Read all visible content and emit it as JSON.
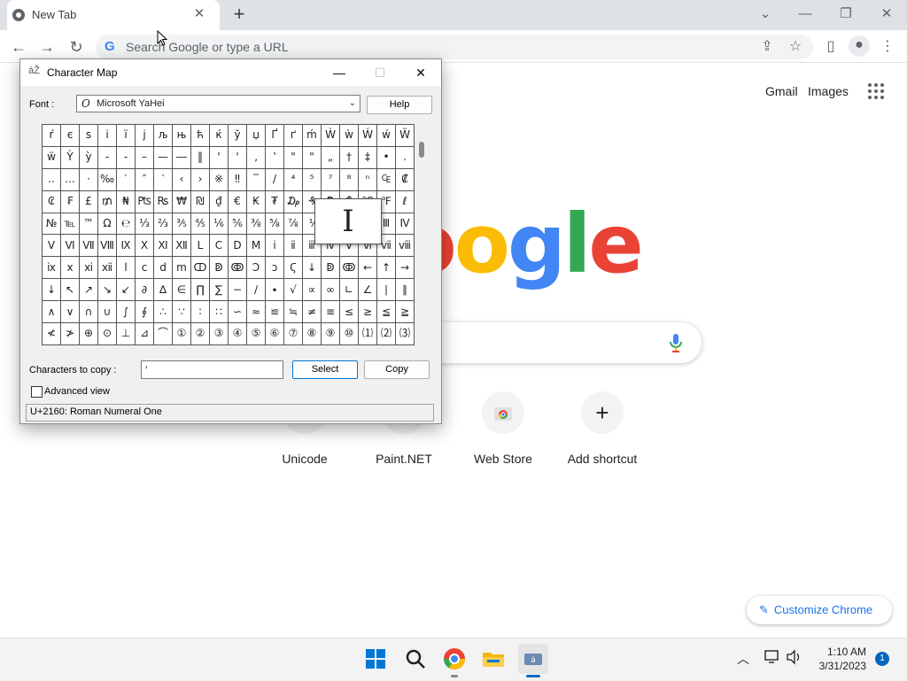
{
  "browser": {
    "tab_title": "New Tab",
    "tab_close": "✕",
    "new_tab": "+",
    "window_controls": {
      "dropdown": "⌄",
      "minimize": "—",
      "restore": "❐",
      "close": "✕"
    },
    "nav": {
      "back": "←",
      "forward": "→",
      "reload": "↻"
    },
    "omnibox_placeholder": "Search Google or type a URL",
    "toolbar_icons": [
      "share-icon",
      "star-icon",
      "sidepanel-icon",
      "profile-icon",
      "menu-icon"
    ]
  },
  "ntp": {
    "gmail": "Gmail",
    "images": "Images",
    "logo": "Google",
    "shortcuts": [
      {
        "label": "Unicode"
      },
      {
        "label": "Paint.NET"
      },
      {
        "label": "Web Store"
      },
      {
        "label": "Add shortcut",
        "icon": "+"
      }
    ],
    "customize": "Customize Chrome",
    "customize_icon": "✎"
  },
  "charmap": {
    "title": "Character Map",
    "controls": {
      "minimize": "—",
      "maximize": "☐",
      "close": "✕"
    },
    "font_label": "Font :",
    "font_glyph": "O",
    "font_value": "Microsoft YaHei",
    "help": "Help",
    "grid": [
      [
        "ŕ",
        "є",
        "s",
        "i",
        "ï",
        "j",
        "љ",
        "њ",
        "ћ",
        "ќ",
        "ў",
        "џ",
        "Ґ",
        "ґ",
        "ḿ",
        "Ẁ",
        "ẁ",
        "Ẃ",
        "ẃ",
        "Ẅ"
      ],
      [
        "ẅ",
        "Ỳ",
        "ỳ",
        "‐",
        "-",
        "–",
        "—",
        "―",
        "‖",
        "'",
        "'",
        "‚",
        "‛",
        "\"",
        "\"",
        "„",
        "†",
        "‡",
        "•",
        "."
      ],
      [
        "..",
        "…",
        "·",
        "‰",
        "′",
        "″",
        "‵",
        "‹",
        "›",
        "※",
        "‼",
        "‾",
        "/",
        "⁴",
        "⁵",
        "⁷",
        "⁸",
        "ⁿ",
        "₠",
        "₡"
      ],
      [
        "₢",
        "₣",
        "£",
        "₥",
        "₦",
        "₧",
        "₨",
        "₩",
        "₪",
        "₫",
        "€",
        "₭",
        "₮",
        "₯",
        "₰",
        "₱",
        "₲",
        "℃",
        "℉",
        "ℓ"
      ],
      [
        "№",
        "℡",
        "™",
        "Ω",
        "℮",
        "⅓",
        "⅔",
        "⅗",
        "⅘",
        "⅙",
        "⅚",
        "⅜",
        "⅝",
        "⅞",
        "⅟",
        "Ⅰ",
        "Ⅱ",
        "Ⅱ",
        "Ⅲ",
        "Ⅳ"
      ],
      [
        "Ⅴ",
        "Ⅵ",
        "Ⅶ",
        "Ⅷ",
        "Ⅸ",
        "Ⅹ",
        "Ⅺ",
        "Ⅻ",
        "Ⅼ",
        "Ⅽ",
        "Ⅾ",
        "Ⅿ",
        "ⅰ",
        "ⅱ",
        "ⅲ",
        "ⅳ",
        "ⅴ",
        "ⅵ",
        "ⅶ",
        "ⅷ"
      ],
      [
        "ⅸ",
        "ⅹ",
        "ⅺ",
        "ⅻ",
        "ⅼ",
        "ⅽ",
        "ⅾ",
        "ⅿ",
        "ↀ",
        "ↁ",
        "ↂ",
        "Ↄ",
        "ↄ",
        "Ϛ",
        "↓",
        "ↁ",
        "ↂ",
        "←",
        "↑",
        "→"
      ],
      [
        "↓",
        "↖",
        "↗",
        "↘",
        "↙",
        "∂",
        "∆",
        "∈",
        "∏",
        "∑",
        "−",
        "∕",
        "∙",
        "√",
        "∝",
        "∞",
        "∟",
        "∠",
        "∣",
        "∥"
      ],
      [
        "∧",
        "∨",
        "∩",
        "∪",
        "∫",
        "∮",
        "∴",
        "∵",
        "∶",
        "∷",
        "∽",
        "≈",
        "≌",
        "≒",
        "≠",
        "≡",
        "≤",
        "≥",
        "≦",
        "≧"
      ],
      [
        "≮",
        "≯",
        "⊕",
        "⊙",
        "⊥",
        "⊿",
        "⌒",
        "①",
        "②",
        "③",
        "④",
        "⑤",
        "⑥",
        "⑦",
        "⑧",
        "⑨",
        "⑩",
        "⑴",
        "⑵",
        "⑶"
      ]
    ],
    "zoom_char": "I",
    "copy_label": "Characters to copy :",
    "copy_value": "′",
    "select": "Select",
    "copy": "Copy",
    "advanced": "Advanced view",
    "status": "U+2160: Roman Numeral One"
  },
  "taskbar": {
    "time": "1:10 AM",
    "date": "3/31/2023",
    "notifications": "1",
    "apps": [
      "windows-start-icon",
      "search-icon",
      "chrome-icon",
      "file-explorer-icon",
      "character-map-icon"
    ]
  }
}
